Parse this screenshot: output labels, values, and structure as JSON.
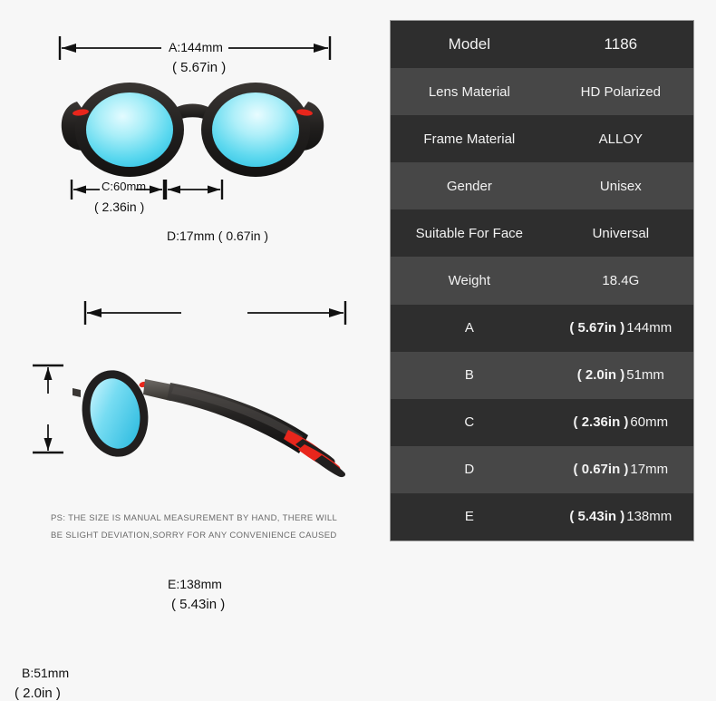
{
  "background_color": "#f7f7f7",
  "product": {
    "type": "sunglasses",
    "frame_color": "#211f1f",
    "lens_color": "#7fe3f0",
    "accent_color": "#e8261c"
  },
  "diagram": {
    "front_view": {
      "name": "front-view",
      "dimensions": {
        "a": {
          "label_mm": "A:144mm",
          "label_in": "( 5.67in )"
        },
        "c": {
          "label_mm": "C:60mm",
          "label_in": "( 2.36in )"
        },
        "d": {
          "label": "D:17mm ( 0.67in )"
        }
      }
    },
    "side_view": {
      "name": "side-view",
      "dimensions": {
        "e": {
          "label_mm": "E:138mm",
          "label_in": "( 5.43in )"
        },
        "b": {
          "label_mm": "B:51mm",
          "label_in": "( 2.0in )"
        }
      }
    },
    "disclaimer_line1": "PS: THE SIZE IS MANUAL MEASUREMENT BY HAND, THERE WILL",
    "disclaimer_line2": "BE SLIGHT DEVIATION,SORRY FOR ANY CONVENIENCE CAUSED"
  },
  "spec_table": {
    "rows": [
      {
        "label": "Model",
        "value": "1186"
      },
      {
        "label": "Lens Material",
        "value": "HD Polarized"
      },
      {
        "label": "Frame Material",
        "value": "ALLOY"
      },
      {
        "label": "Gender",
        "value": "Unisex"
      },
      {
        "label": "Suitable For Face",
        "value": "Universal"
      },
      {
        "label": "Weight",
        "value": "18.4G"
      }
    ],
    "measurements": [
      {
        "label": "A",
        "inches": "( 5.67in )",
        "mm": "144mm"
      },
      {
        "label": "B",
        "inches": "( 2.0in )",
        "mm": "51mm"
      },
      {
        "label": "C",
        "inches": "( 2.36in )",
        "mm": "60mm"
      },
      {
        "label": "D",
        "inches": "( 0.67in )",
        "mm": "17mm"
      },
      {
        "label": "E",
        "inches": "( 5.43in )",
        "mm": "138mm"
      }
    ]
  }
}
